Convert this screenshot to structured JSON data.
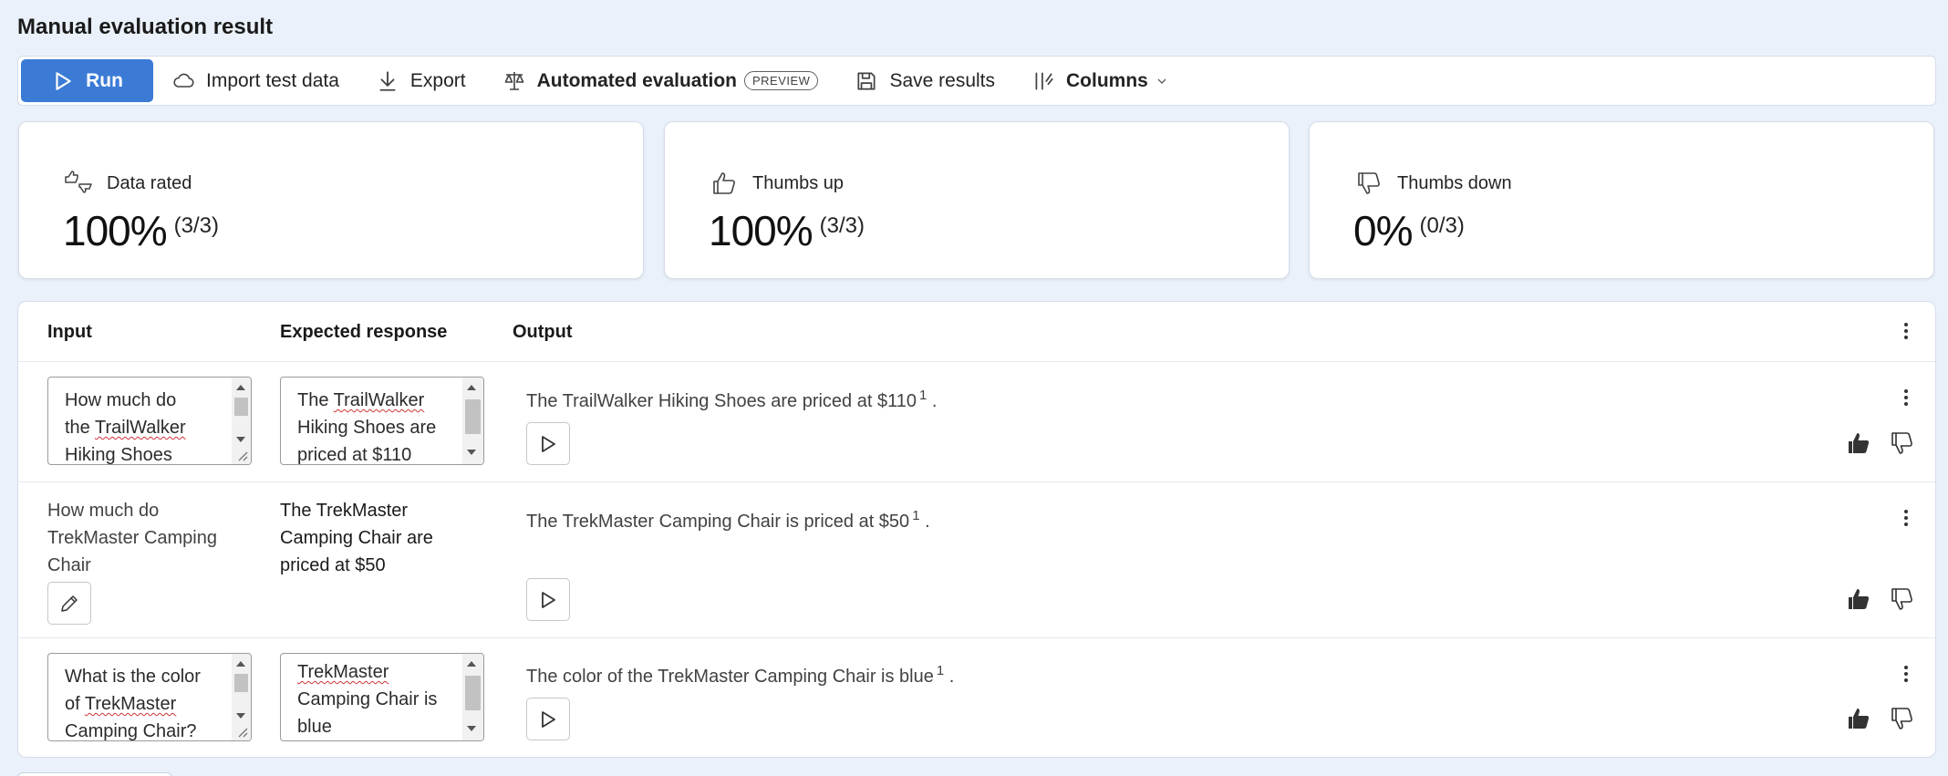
{
  "page": {
    "title": "Manual evaluation result"
  },
  "toolbar": {
    "run": "Run",
    "import": "Import test data",
    "export": "Export",
    "automated": "Automated evaluation",
    "preview_badge": "PREVIEW",
    "save": "Save results",
    "columns": "Columns"
  },
  "stats": {
    "rated": {
      "label": "Data rated",
      "percent": "100%",
      "fraction": "(3/3)"
    },
    "up": {
      "label": "Thumbs up",
      "percent": "100%",
      "fraction": "(3/3)"
    },
    "down": {
      "label": "Thumbs down",
      "percent": "0%",
      "fraction": "(0/3)"
    }
  },
  "table": {
    "headers": {
      "input": "Input",
      "expected": "Expected response",
      "output": "Output"
    },
    "rows": [
      {
        "input_lines": [
          "How much do",
          "the TrailWalker",
          "Hiking Shoes"
        ],
        "expected_lines": [
          "The TrailWalker",
          "Hiking Shoes are",
          "priced at $110"
        ],
        "output": "The TrailWalker Hiking Shoes are priced at $110",
        "citation": "1",
        "output_end": "."
      },
      {
        "input_lines": [
          "How much do",
          "TrekMaster Camping",
          "Chair"
        ],
        "expected_lines": [
          "The TrekMaster",
          "Camping Chair are",
          "priced at $50"
        ],
        "output": "The TrekMaster Camping Chair is priced at $50",
        "citation": "1",
        "output_end": "."
      },
      {
        "input_lines": [
          "What is the color",
          "of TrekMaster",
          "Camping Chair?"
        ],
        "expected_lines": [
          "TrekMaster",
          "Camping Chair is",
          "blue"
        ],
        "output": "The color of the TrekMaster Camping Chair is blue",
        "citation": "1",
        "output_end": "."
      }
    ]
  },
  "colors": {
    "accent": "#3b7bd6",
    "background": "#eaf1fa"
  }
}
